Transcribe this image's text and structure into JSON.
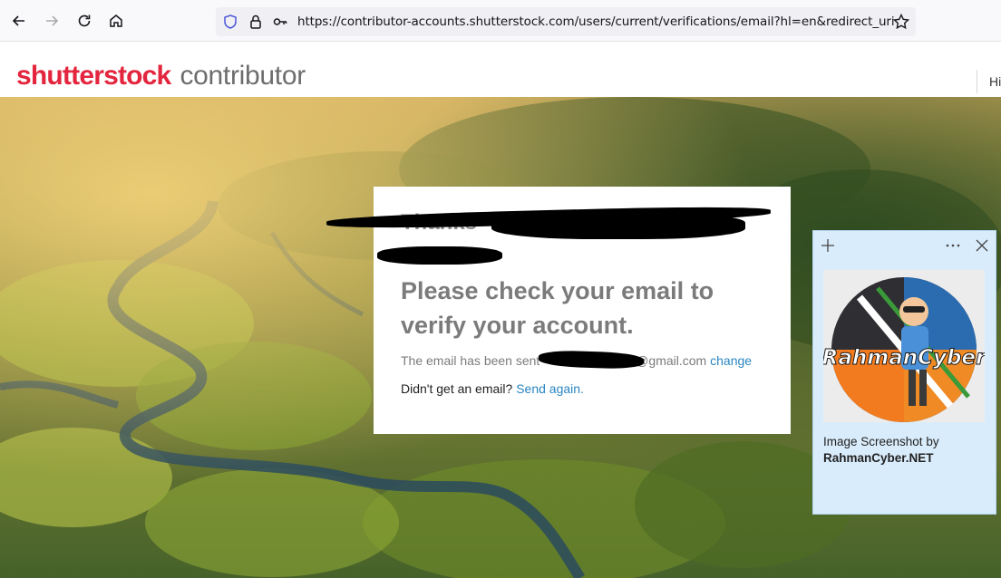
{
  "browser": {
    "url": "https://contributor-accounts.shutterstock.com/users/current/verifications/email?hl=en&redirect_uri=https%",
    "icons": [
      "back-icon",
      "forward-icon",
      "reload-icon",
      "home-icon",
      "shield-icon",
      "lock-icon",
      "key-icon",
      "star-icon"
    ]
  },
  "header": {
    "logo_main": "shutterstock",
    "logo_sub": "contributor",
    "greeting": "Hi"
  },
  "card": {
    "greeting": "Thanks",
    "heading": "Please check your email to verify your account.",
    "sent_prefix": "The email has been sent",
    "sent_domain": "@gmail.com",
    "change_link": "change",
    "didnt_get": "Didn't get an email?",
    "send_again_link": "Send again."
  },
  "panel": {
    "caption_line1": "Image Screenshot by",
    "caption_line2": "RahmanCyber.NET",
    "image_text": "RahmanCyber",
    "icons": [
      "plus-icon",
      "more-icon",
      "close-icon"
    ]
  },
  "colors": {
    "brand_red": "#e3253e",
    "link_blue": "#2a86c1",
    "panel_bg": "#d9ecfb"
  }
}
